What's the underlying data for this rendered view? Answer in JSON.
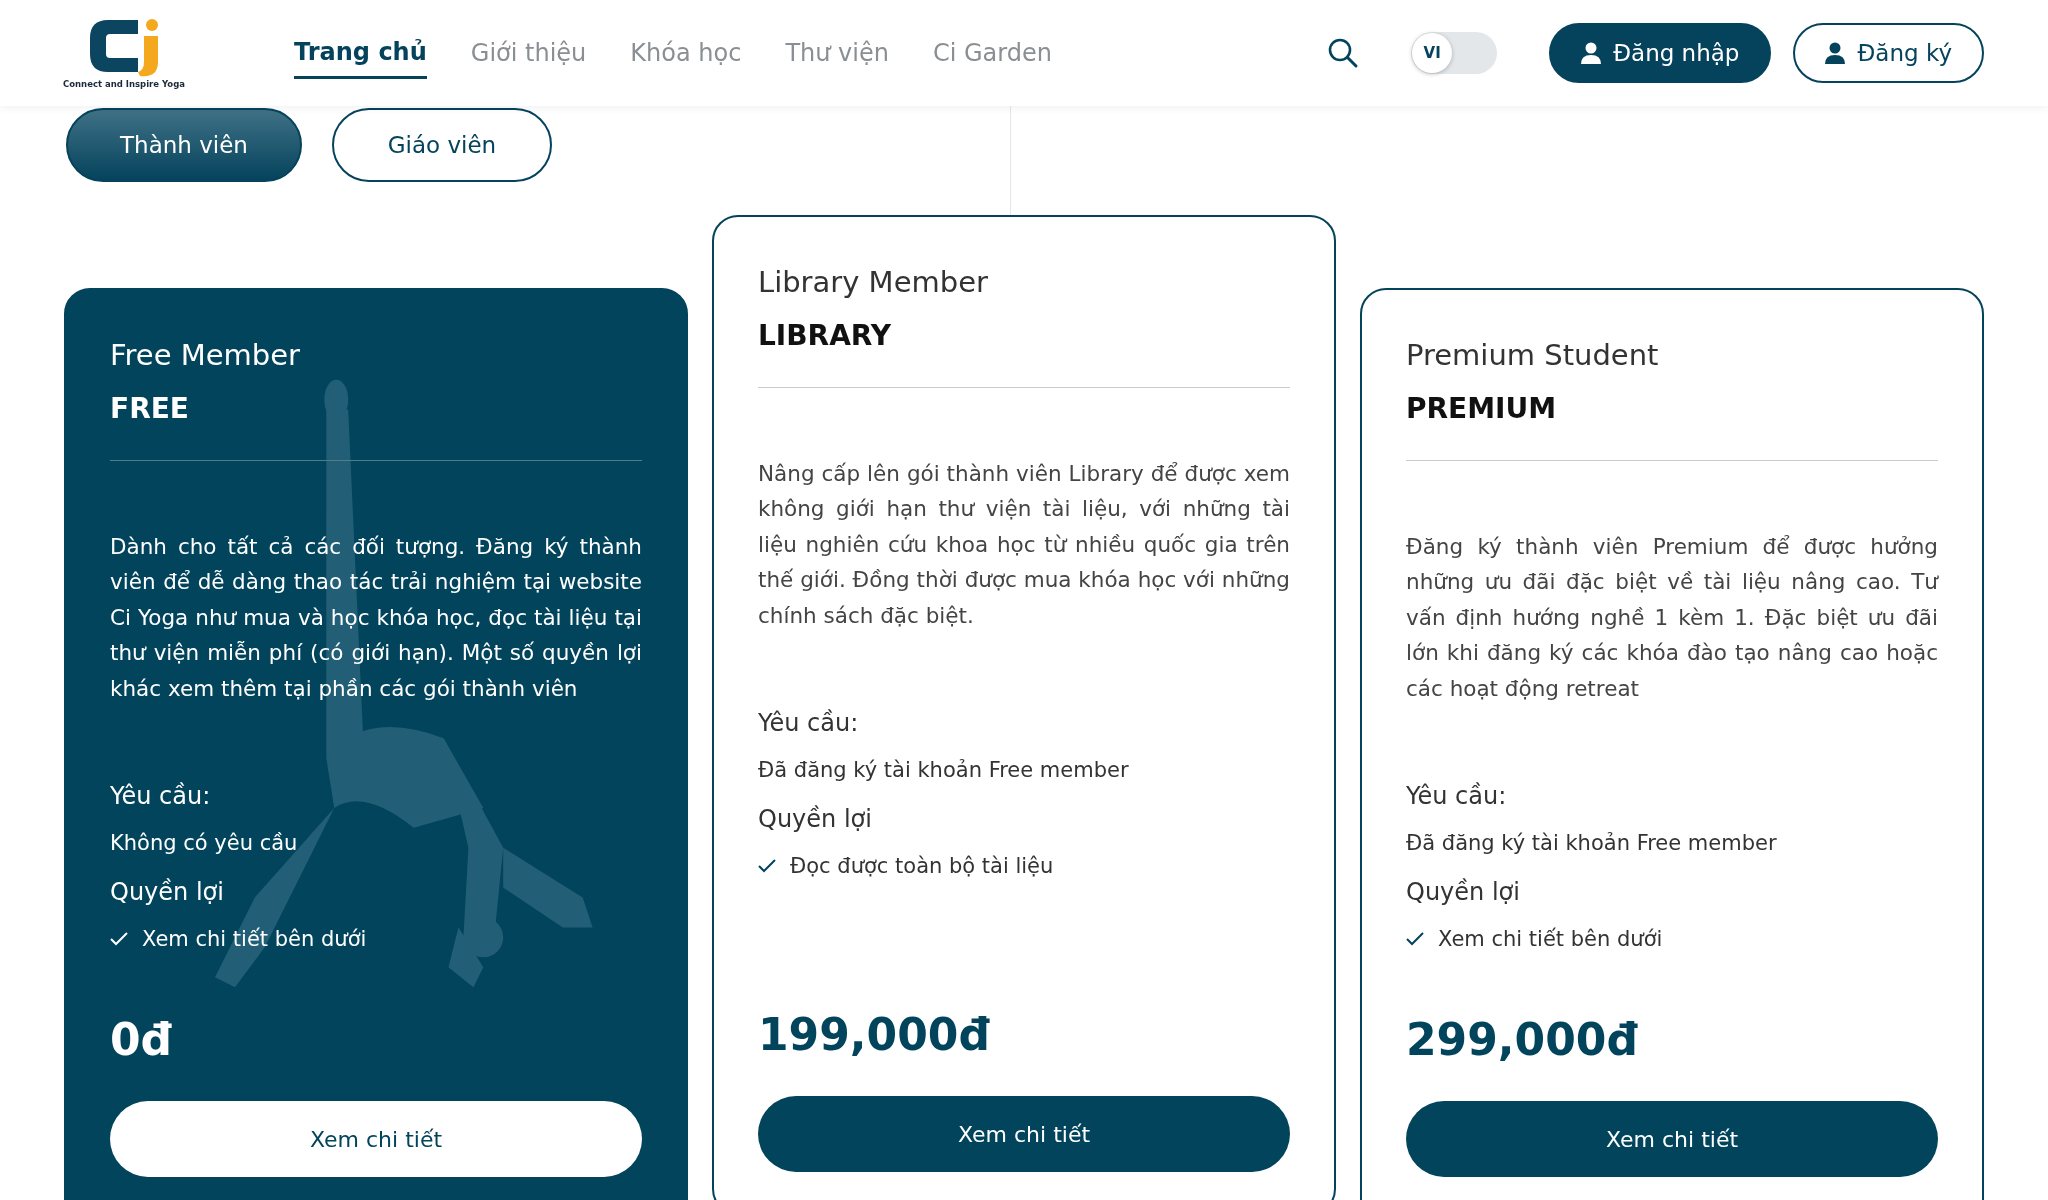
{
  "header": {
    "logo_tagline": "Connect and Inspire Yoga",
    "nav": [
      {
        "label": "Trang chủ",
        "selected": true
      },
      {
        "label": "Giới thiệu",
        "selected": false
      },
      {
        "label": "Khóa học",
        "selected": false
      },
      {
        "label": "Thư viện",
        "selected": false
      },
      {
        "label": "Ci Garden",
        "selected": false
      }
    ],
    "language": {
      "code": "VI",
      "on": false
    },
    "buttons": [
      {
        "label": "Đăng nhập",
        "kind": "primary"
      },
      {
        "label": "Đăng ký",
        "kind": "outline"
      }
    ]
  },
  "member_tabs": [
    {
      "label": "Thành viên",
      "selected": true
    },
    {
      "label": "Giáo viên",
      "selected": false
    }
  ],
  "plans": [
    {
      "name": "Free Member",
      "code": "FREE",
      "featured": true,
      "raised": false,
      "description": "Dành cho tất cả các đối tượng. Đăng ký thành viên để dễ dàng thao tác trải nghiệm tại website Ci Yoga như mua và học khóa học, đọc tài liệu tại thư viện miễn phí (có giới hạn). Một số quyền lợi khác xem thêm tại phần các gói thành viên",
      "requirement_label": "Yêu cầu:",
      "requirement": "Không có yêu cầu",
      "benefits_label": "Quyền lợi",
      "benefits": [
        "Xem chi tiết bên dưới"
      ],
      "price": "0đ",
      "button": "Xem chi tiết"
    },
    {
      "name": "Library Member",
      "code": "LIBRARY",
      "featured": false,
      "raised": true,
      "description": "Nâng cấp lên gói thành viên Library để được xem không giới hạn thư viện tài liệu, với những tài liệu nghiên cứu khoa học từ nhiều quốc gia trên thế giới. Đồng thời được mua khóa học với những chính sách đặc biệt.",
      "requirement_label": "Yêu cầu:",
      "requirement": "Đã đăng ký tài khoản Free member",
      "benefits_label": "Quyền lợi",
      "benefits": [
        "Đọc được toàn bộ tài liệu"
      ],
      "price": "199,000đ",
      "button": "Xem chi tiết"
    },
    {
      "name": "Premium Student",
      "code": "PREMIUM",
      "featured": false,
      "raised": false,
      "description": "Đăng ký thành viên Premium để được hưởng những ưu đãi đặc biệt về tài liệu nâng cao. Tư vấn định hướng nghề 1 kèm 1. Đặc biệt ưu đãi lớn khi đăng ký các khóa đào tạo nâng cao hoặc các hoạt động retreat",
      "requirement_label": "Yêu cầu:",
      "requirement": "Đã đăng ký tài khoản Free member",
      "benefits_label": "Quyền lợi",
      "benefits": [
        "Xem chi tiết bên dưới"
      ],
      "price": "299,000đ",
      "button": "Xem chi tiết"
    }
  ]
}
